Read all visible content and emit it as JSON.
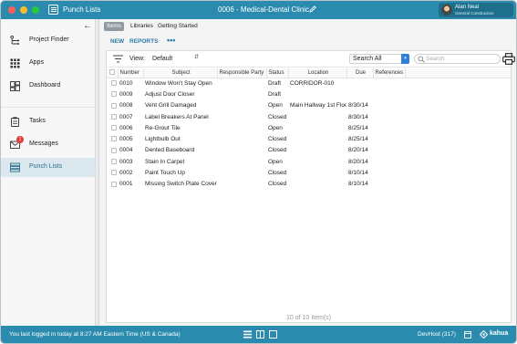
{
  "titlebar": {
    "app_title": "Punch Lists",
    "document_title": "0006 - Medical-Dental Clinic",
    "user": {
      "name": "Alan Neal",
      "company": "General Construction"
    }
  },
  "sidebar": {
    "items": [
      {
        "label": "Project Finder",
        "icon": "project-finder-icon"
      },
      {
        "label": "Apps",
        "icon": "apps-grid-icon"
      },
      {
        "label": "Dashboard",
        "icon": "dashboard-icon"
      },
      {
        "label": "Tasks",
        "icon": "clipboard-icon"
      },
      {
        "label": "Messages",
        "icon": "envelope-icon",
        "badge": "1"
      },
      {
        "label": "Punch Lists",
        "icon": "list-icon",
        "active": true
      }
    ]
  },
  "main": {
    "tabs": [
      "Items",
      "Libraries",
      "Getting Started"
    ],
    "actions": {
      "new": "NEW",
      "reports": "REPORTS",
      "more": "•••"
    },
    "filter": {
      "view_label": "View:",
      "view_value": "Default",
      "search_scope": "Search All",
      "search_placeholder": "Search"
    },
    "table": {
      "columns": [
        "Number",
        "Subject",
        "Responsible Party",
        "Status",
        "Location",
        "Due",
        "References"
      ],
      "rows": [
        {
          "number": "0010",
          "subject": "Window Won't Stay Open",
          "party": "",
          "status": "Draft",
          "location": "CORRIDOR-010",
          "due": "",
          "refs": ""
        },
        {
          "number": "0009",
          "subject": "Adjust Door Closer",
          "party": "",
          "status": "Draft",
          "location": "",
          "due": "",
          "refs": ""
        },
        {
          "number": "0008",
          "subject": "Vent Grill Damaged",
          "party": "",
          "status": "Open",
          "location": "Main Hallway 1st Floor",
          "due": "8/30/14",
          "refs": ""
        },
        {
          "number": "0007",
          "subject": "Label Breakers At Panel",
          "party": "",
          "status": "Closed",
          "location": "",
          "due": "8/30/14",
          "refs": ""
        },
        {
          "number": "0006",
          "subject": "Re-Grout Tile",
          "party": "",
          "status": "Open",
          "location": "",
          "due": "8/25/14",
          "refs": ""
        },
        {
          "number": "0005",
          "subject": "Lightbulb Out",
          "party": "",
          "status": "Closed",
          "location": "",
          "due": "8/25/14",
          "refs": ""
        },
        {
          "number": "0004",
          "subject": "Dented Baseboard",
          "party": "",
          "status": "Closed",
          "location": "",
          "due": "8/20/14",
          "refs": ""
        },
        {
          "number": "0003",
          "subject": "Stain In Carpet",
          "party": "",
          "status": "Open",
          "location": "",
          "due": "8/20/14",
          "refs": ""
        },
        {
          "number": "0002",
          "subject": "Paint Touch Up",
          "party": "",
          "status": "Closed",
          "location": "",
          "due": "8/10/14",
          "refs": ""
        },
        {
          "number": "0001",
          "subject": "Missing Switch Plate Cover",
          "party": "",
          "status": "Closed",
          "location": "",
          "due": "8/10/14",
          "refs": ""
        }
      ]
    },
    "item_count": "10 of 10 Item(s)"
  },
  "statusbar": {
    "login_text": "You last logged in today at 8:27 AM Eastern Time (US & Canada)",
    "devhost": "DevHost (317)",
    "brand": "kahua"
  },
  "colors": {
    "accent": "#2b8bae",
    "link": "#2b7aa6",
    "active_nav": "#dbe8ef"
  }
}
